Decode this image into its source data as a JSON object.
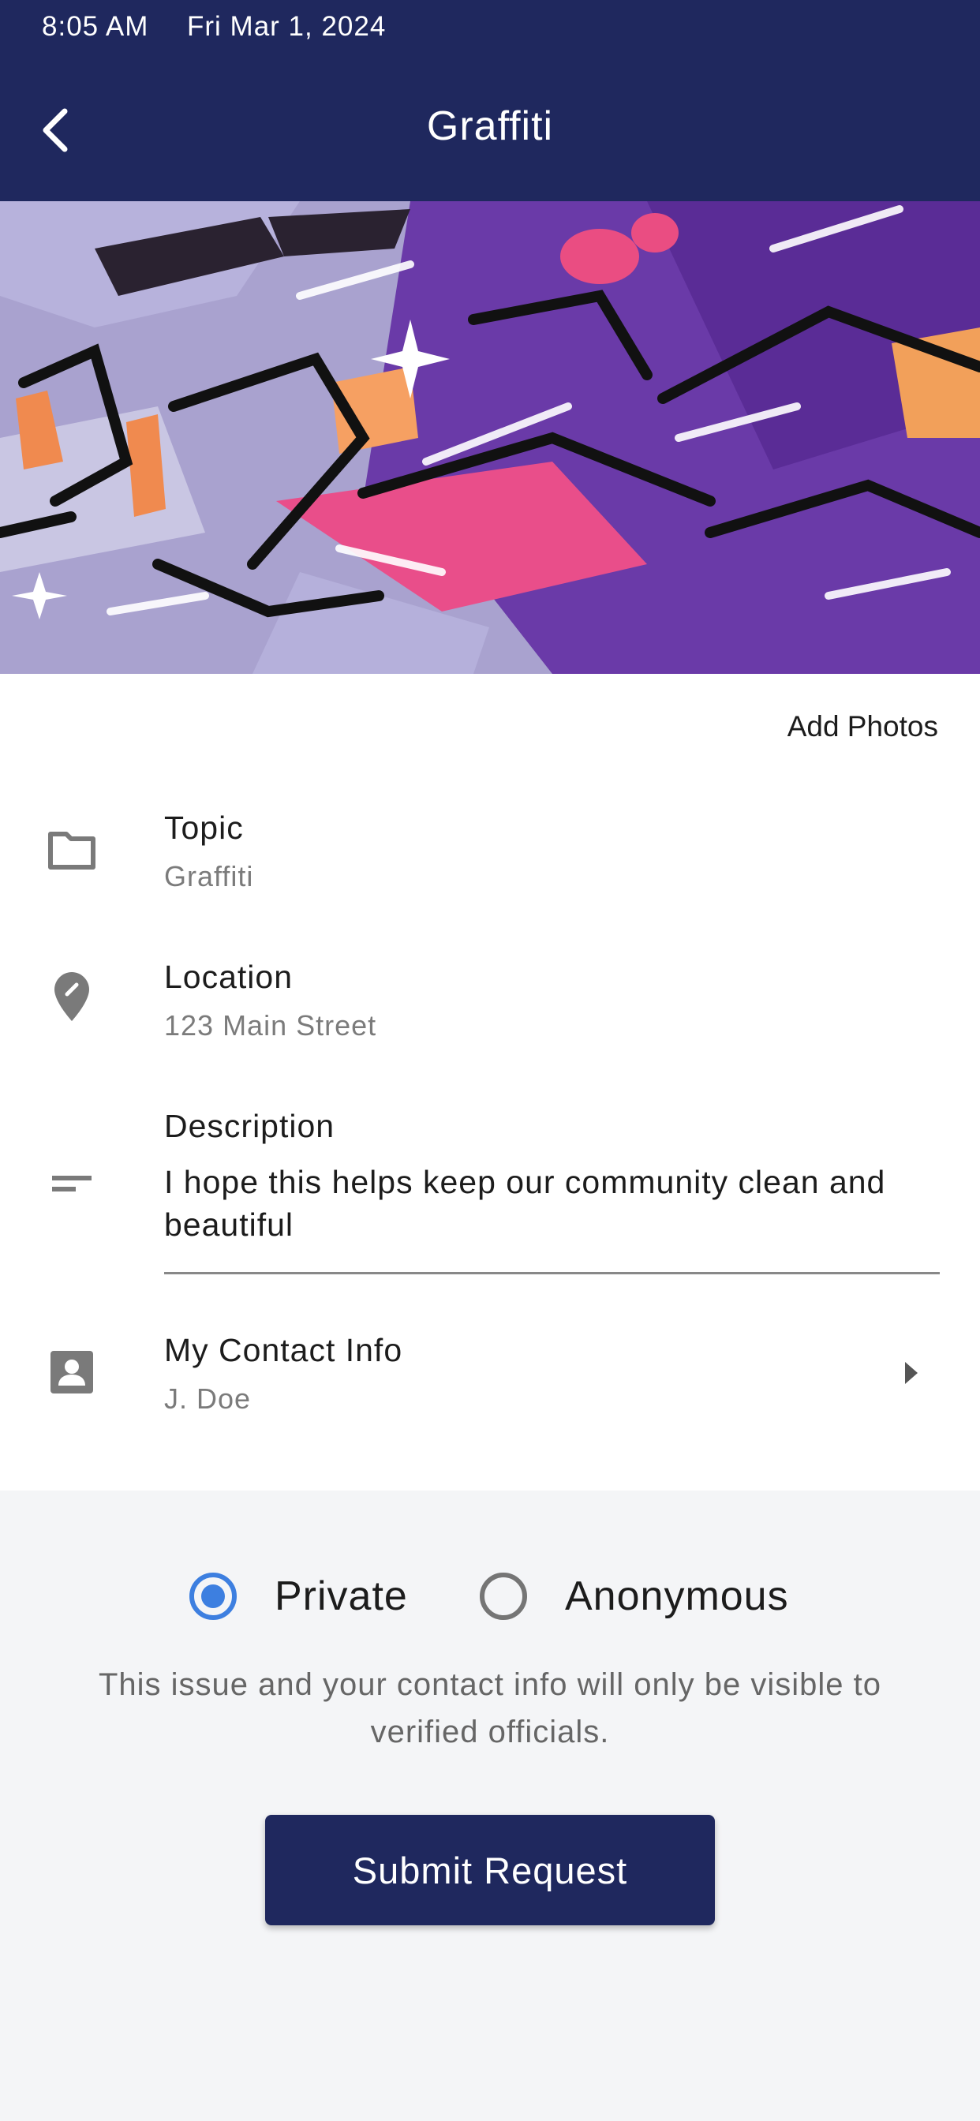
{
  "status_bar": {
    "time": "8:05 AM",
    "date": "Fri Mar 1, 2024"
  },
  "header": {
    "title": "Graffiti",
    "back_icon": "chevron-left-icon"
  },
  "photo": {
    "subject": "graffiti-photo"
  },
  "add_photos_label": "Add Photos",
  "fields": {
    "topic": {
      "label": "Topic",
      "value": "Graffiti",
      "icon": "folder-icon"
    },
    "location": {
      "label": "Location",
      "value": "123 Main Street",
      "icon": "map-pin-icon"
    },
    "description": {
      "label": "Description",
      "value": "I hope this helps keep our community clean and beautiful",
      "icon": "short-text-icon"
    },
    "contact": {
      "label": "My Contact Info",
      "value": "J. Doe",
      "icon": "contact-card-icon"
    }
  },
  "privacy": {
    "options": [
      {
        "label": "Private",
        "selected": true
      },
      {
        "label": "Anonymous",
        "selected": false
      }
    ],
    "note": "This issue and your contact info will only be visible to verified officials."
  },
  "submit_label": "Submit Request",
  "colors": {
    "primary": "#1f285e",
    "radio_accent": "#3d7fe0",
    "icon_gray": "#7a7a7a"
  }
}
